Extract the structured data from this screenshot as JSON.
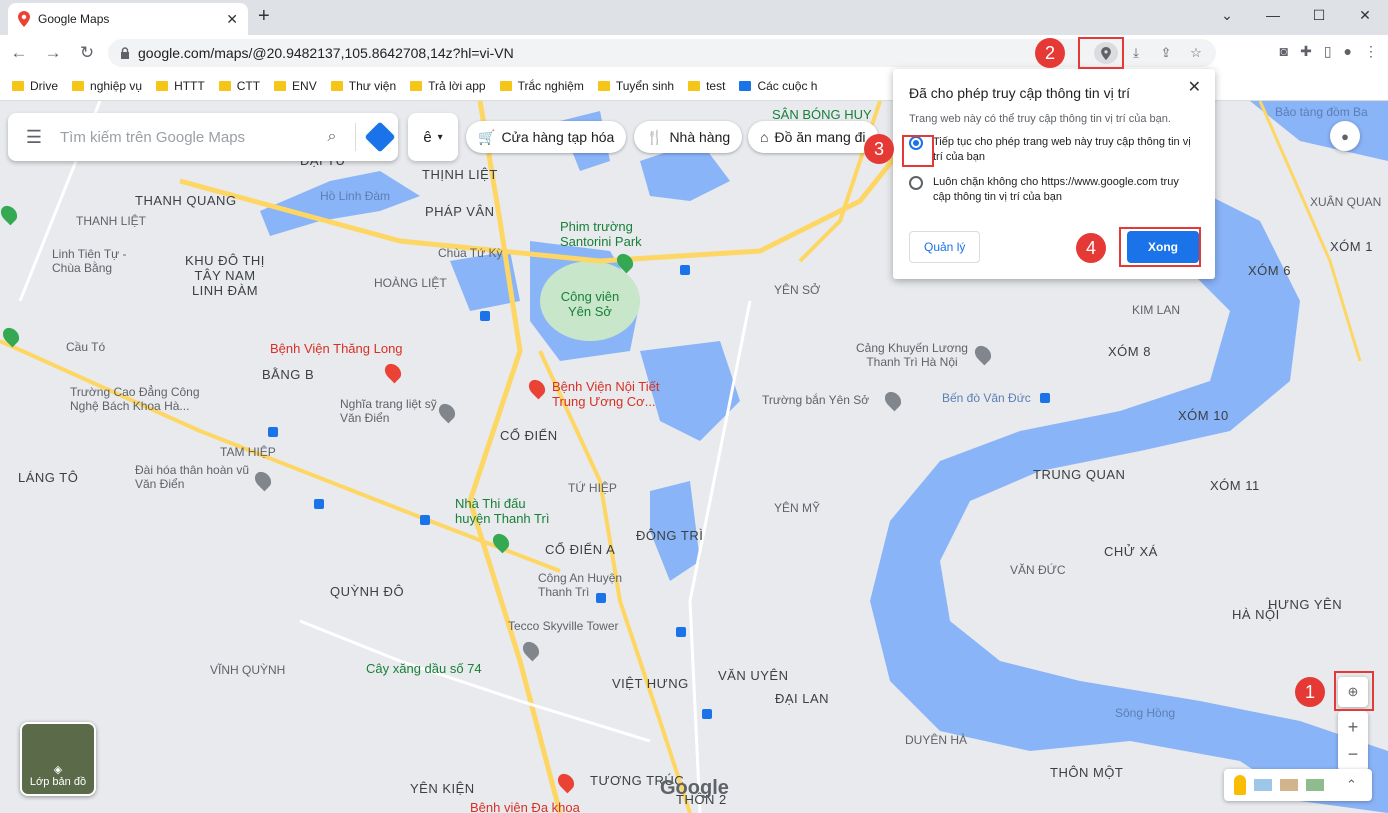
{
  "browser": {
    "tab_title": "Google Maps",
    "url": "google.com/maps/@20.9482137,105.8642708,14z?hl=vi-VN",
    "bookmarks": [
      "Drive",
      "nghiệp vụ",
      "HTTT",
      "CTT",
      "ENV",
      "Thư viện",
      "Trả lời app",
      "Trắc nghiệm",
      "Tuyển sinh",
      "test",
      "Các cuộc h"
    ]
  },
  "maps": {
    "search_placeholder": "Tìm kiếm trên Google Maps",
    "lang_glyph": "ê",
    "chips": [
      "Cửa hàng tạp hóa",
      "Nhà hàng",
      "Đồ ăn mang đi"
    ],
    "layers_label": "Lớp bản đồ",
    "logo": "Google",
    "labels": [
      {
        "t": "THANH QUANG",
        "c": "big"
      },
      {
        "t": "THỊNH LIỆT",
        "c": "big"
      },
      {
        "t": "PHÁP VÂN",
        "c": "big"
      },
      {
        "t": "Hồ Linh Đàm",
        "c": "blue"
      },
      {
        "t": "Phim trường Santorini Park",
        "c": "green"
      },
      {
        "t": "Công viên Yên Sở",
        "c": "green"
      },
      {
        "t": "Linh Tiên Tự - Chùa Bằng",
        "c": ""
      },
      {
        "t": "KHU ĐÔ THỊ TÂY NAM LINH ĐÀM",
        "c": "big"
      },
      {
        "t": "Chùa Tứ Kỳ",
        "c": ""
      },
      {
        "t": "Bệnh Viện Thăng Long",
        "c": "red"
      },
      {
        "t": "BẰNG B",
        "c": "big"
      },
      {
        "t": "Bệnh Viện Nội Tiết Trung Ương Cơ...",
        "c": "red"
      },
      {
        "t": "Cầu Tó",
        "c": ""
      },
      {
        "t": "Trường Cao Đẳng Công Nghệ Bách Khoa Hà...",
        "c": ""
      },
      {
        "t": "Nghĩa trang liệt sỹ Văn Điển",
        "c": ""
      },
      {
        "t": "CỔ ĐIỂN",
        "c": "big"
      },
      {
        "t": "Đài hóa thân hoàn vũ Văn Điển",
        "c": ""
      },
      {
        "t": "LÁNG TÔ",
        "c": "big"
      },
      {
        "t": "Nhà Thi đấu huyện Thanh Trì",
        "c": "green"
      },
      {
        "t": "ĐÔNG TRÌ",
        "c": "big"
      },
      {
        "t": "CỔ ĐIỂN A",
        "c": "big"
      },
      {
        "t": "Công An Huyện Thanh Trì",
        "c": ""
      },
      {
        "t": "QUỲNH ĐÔ",
        "c": "big"
      },
      {
        "t": "Tecco Skyville Tower",
        "c": ""
      },
      {
        "t": "Cây xăng dầu số 74",
        "c": "green"
      },
      {
        "t": "VĨNH QUỲNH",
        "c": ""
      },
      {
        "t": "VIỆT HƯNG",
        "c": "big"
      },
      {
        "t": "VĂN UYÊN",
        "c": "big"
      },
      {
        "t": "ĐẠI LAN",
        "c": "big"
      },
      {
        "t": "DUYÊN HÀ",
        "c": ""
      },
      {
        "t": "YÊN KIỆN",
        "c": "big"
      },
      {
        "t": "TƯƠNG TRÚC",
        "c": "big"
      },
      {
        "t": "Cảng Khuyến Lương Thanh Trì Hà Nội",
        "c": ""
      },
      {
        "t": "Trường bắn Yên Sở",
        "c": ""
      },
      {
        "t": "Bến đò Văn Đức",
        "c": "blue"
      },
      {
        "t": "TRUNG QUAN",
        "c": "big"
      },
      {
        "t": "Sông Hồng",
        "c": "blue"
      },
      {
        "t": "CHỬ XÁ",
        "c": "big"
      },
      {
        "t": "VĂN ĐỨC",
        "c": ""
      },
      {
        "t": "XÓM 11",
        "c": "big"
      },
      {
        "t": "XÓM 10",
        "c": "big"
      },
      {
        "t": "XÓM 8",
        "c": "big"
      },
      {
        "t": "KIM LAN",
        "c": ""
      },
      {
        "t": "XÓM 6",
        "c": "big"
      },
      {
        "t": "XÓM 1",
        "c": "big"
      },
      {
        "t": "XUÂN QUAN",
        "c": ""
      },
      {
        "t": "THÔN MỘT",
        "c": "big"
      },
      {
        "t": "HÀ NỘI",
        "c": "big"
      },
      {
        "t": "HƯNG YÊN",
        "c": "big"
      },
      {
        "t": "Bảo tàng đồm Ba",
        "c": "blue"
      },
      {
        "t": "SÂN BÓNG HUY",
        "c": "green"
      },
      {
        "t": "YÊN SỞ",
        "c": ""
      },
      {
        "t": "TAM HIỆP",
        "c": ""
      },
      {
        "t": "THANH LIỆT",
        "c": ""
      },
      {
        "t": "ĐẠI TỪ",
        "c": "big"
      },
      {
        "t": "HOÀNG LIỆT",
        "c": ""
      },
      {
        "t": "TỨ HIỆP",
        "c": ""
      },
      {
        "t": "YÊN MỸ",
        "c": ""
      },
      {
        "t": "Bệnh viện Đa khoa",
        "c": "red"
      },
      {
        "t": "THÔN 2",
        "c": "big"
      }
    ]
  },
  "popup": {
    "title": "Đã cho phép truy cập thông tin vị trí",
    "subtitle": "Trang web này có thể truy cập thông tin vị trí của bạn.",
    "option1": "Tiếp tục cho phép trang web này truy cập thông tin vị trí của bạn",
    "option2": "Luôn chặn không cho https://www.google.com truy cập thông tin vị trí của bạn",
    "manage": "Quản lý",
    "done": "Xong"
  },
  "annotations": [
    "1",
    "2",
    "3",
    "4"
  ],
  "colors": {
    "accent": "#1a73e8",
    "annotation": "#e53935",
    "water": "#8ab4f8",
    "road": "#fdd663"
  }
}
